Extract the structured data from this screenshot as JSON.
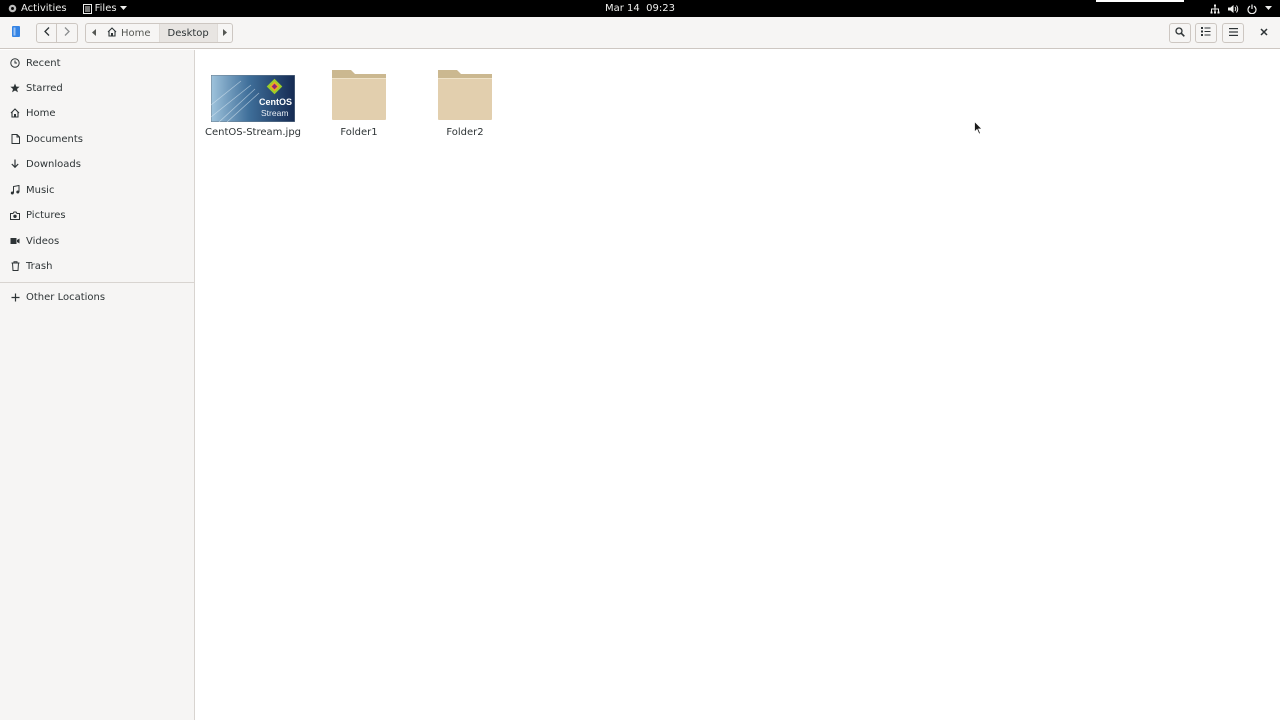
{
  "topbar": {
    "activities_label": "Activities",
    "app_name": "Files",
    "clock": "Mar 14  09:23"
  },
  "headerbar": {
    "path": [
      {
        "label": "Home",
        "icon": "home-icon"
      },
      {
        "label": "Desktop",
        "active": true
      }
    ]
  },
  "sidebar": {
    "items": [
      {
        "label": "Recent",
        "icon": "clock-icon"
      },
      {
        "label": "Starred",
        "icon": "star-icon"
      },
      {
        "label": "Home",
        "icon": "home-icon"
      },
      {
        "label": "Documents",
        "icon": "document-icon"
      },
      {
        "label": "Downloads",
        "icon": "download-icon"
      },
      {
        "label": "Music",
        "icon": "music-icon"
      },
      {
        "label": "Pictures",
        "icon": "camera-icon"
      },
      {
        "label": "Videos",
        "icon": "video-icon"
      },
      {
        "label": "Trash",
        "icon": "trash-icon"
      }
    ],
    "other_locations": {
      "label": "Other Locations",
      "icon": "plus-icon"
    }
  },
  "files": [
    {
      "name": "CentOS-Stream.jpg",
      "type": "image",
      "thumb_text_1": "CentOS",
      "thumb_text_2": "Stream"
    },
    {
      "name": "Folder1",
      "type": "folder"
    },
    {
      "name": "Folder2",
      "type": "folder"
    }
  ],
  "colors": {
    "folder": "#e2cfae",
    "folder_tab": "#cbb890",
    "sidebar_bg": "#f6f5f4",
    "topbar_bg": "#000000"
  }
}
